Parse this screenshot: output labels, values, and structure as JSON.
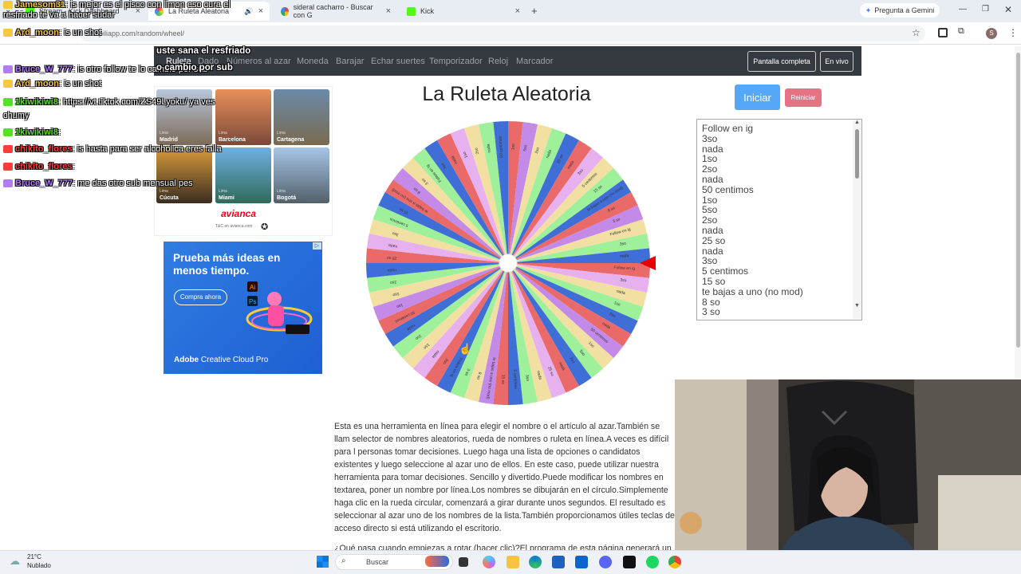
{
  "browser": {
    "tabs": [
      {
        "label": "Stream - Kick Dashboard",
        "active": false
      },
      {
        "label": "La Ruleta Aleatoria",
        "active": true
      },
      {
        "label": "sideral cacharro - Buscar con G",
        "active": false
      },
      {
        "label": "Kick",
        "active": false
      }
    ],
    "url": "es.piliapp.com/random/wheel/",
    "gemini_label": "Pregunta a Gemini",
    "profile_initial": "S"
  },
  "site": {
    "nav": [
      "Ruleta",
      "Dado",
      "Números al azar",
      "Moneda",
      "Barajar",
      "Echar suertes",
      "Temporizador",
      "Reloj",
      "Marcador"
    ],
    "fullscreen_label": "Pantalla completa",
    "live_label": "En vivo",
    "title": "La Ruleta Aleatoria",
    "start_label": "Iniciar",
    "reset_label": "Reiniciar",
    "names": [
      "Follow en ig",
      "3so",
      "nada",
      "1so",
      "2so",
      "nada",
      "50 centimos",
      "1so",
      "5so",
      "2so",
      "nada",
      "25 so",
      "nada",
      "3so",
      "5 centimos",
      "15 so",
      "te bajas a uno (no mod)",
      "8 so",
      "3 so"
    ],
    "description": "Esta es una herramienta en línea para elegir el nombre o el artículo al azar.También se llam selector de nombres aleatorios, rueda de nombres o ruleta en línea.A veces es difícil para l personas tomar decisiones. Luego haga una lista de opciones o candidatos existentes y luego seleccione al azar uno de ellos. En este caso, puede utilizar nuestra herramienta para tomar decisiones. Sencillo y divertido.Puede modificar los nombres en textarea, poner un nombre por línea.Los nombres se dibujarán en el círculo.Simplemente haga clic en la rueda circular, comenzará a girar durante unos segundos. El resultado es seleccionar al azar uno de los nombres de la lista.También proporcionamos útiles teclas de acceso directo si está utilizando el escritorio.",
    "description2": "¿Qué pasa cuando empiezas a rotar (hacer clic)?El programa de esta página generará un"
  },
  "ads": {
    "avianca": {
      "cities": [
        {
          "dest": "Lima",
          "name": "Madrid"
        },
        {
          "dest": "Lima",
          "name": "Barcelona"
        },
        {
          "dest": "Lima",
          "name": "Cartagena"
        },
        {
          "dest": "Lima",
          "name": "Cúcuta"
        },
        {
          "dest": "Lima",
          "name": "Miami"
        },
        {
          "dest": "Lima",
          "name": "Bogotá"
        }
      ],
      "brand": "avianca",
      "legal": "T&C en avianca.com"
    },
    "adobe": {
      "headline": "Prueba más ideas en menos tiempo.",
      "cta": "Compra ahora",
      "brand": "Adobe",
      "product": "Creative Cloud Pro"
    }
  },
  "chat": [
    {
      "user": "Jamesom31",
      "color": "#f5c842",
      "msg": ": is mejor es el pisco con limon eso cura el resfriado te va a hacer sudar"
    },
    {
      "user": "Ard_moon",
      "color": "#f5c842",
      "msg": ": is un shot"
    },
    {
      "user": "Bruce_W_777",
      "color": "#b17cf4",
      "msg": ": is otro follow te lo cambio por sub"
    },
    {
      "user": "Ard_moon",
      "color": "#f5c842",
      "msg": ": is un shot"
    },
    {
      "user": "1kiwikiwi8",
      "color": "#57e02a",
      "msg": ": https://vt.tiktok.com/ZS49Lyoku/ ya ves chumy"
    },
    {
      "user": "1kiwikiwi8",
      "color": "#57e02a",
      "msg": ":"
    },
    {
      "user": "chikito_flores",
      "color": "#ff3b3b",
      "msg": ": is hasta para ser alcoholica eres falla"
    },
    {
      "user": "chikito_flores",
      "color": "#ff3b3b",
      "msg": ":"
    },
    {
      "user": "Bruce_W_777",
      "color": "#b17cf4",
      "msg": ": me das otro sub mensual pes"
    }
  ],
  "chat_overlay": {
    "line": "uste sana el resfriado",
    "line2": "o cambio por sub"
  },
  "taskbar": {
    "weather_temp": "21°C",
    "weather_desc": "Nublado",
    "search_placeholder": "Buscar"
  },
  "wheel": {
    "colors": [
      "#ea6a6a",
      "#e7b0ee",
      "#f2e0a3",
      "#9ef09a",
      "#3f6fd6",
      "#ea6a6a",
      "#c38ae8",
      "#f2e0a3",
      "#9ef09a",
      "#3f6fd6"
    ],
    "segments": 60,
    "pointer_color": "#e60000"
  }
}
